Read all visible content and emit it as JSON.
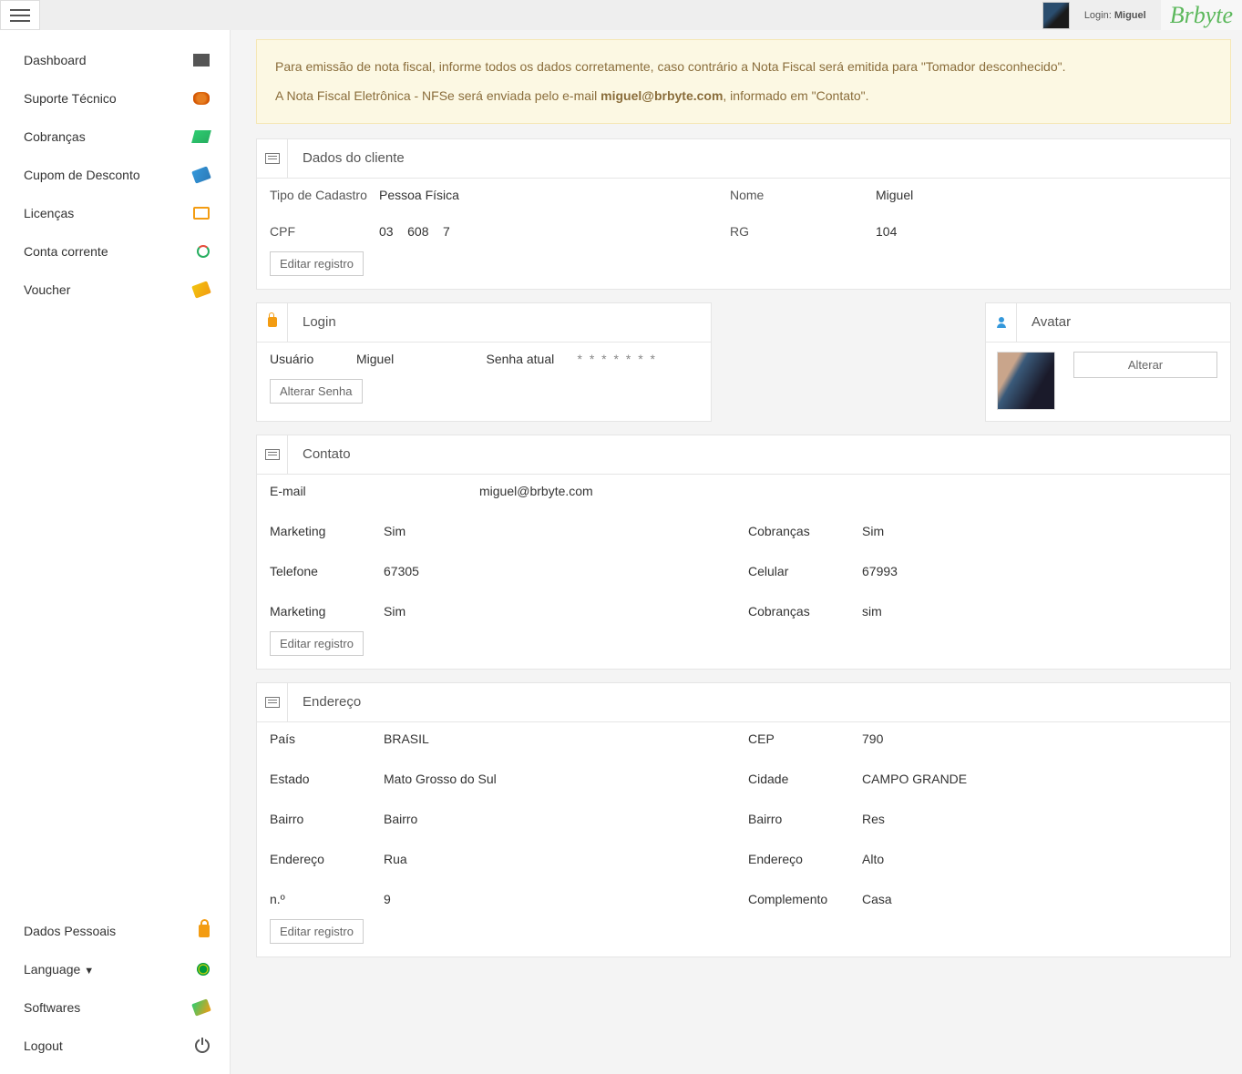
{
  "topbar": {
    "login_prefix": "Login: ",
    "login_name": "Miguel",
    "brand": "Brbyte"
  },
  "sidebar": {
    "top": [
      {
        "label": "Dashboard",
        "icon": "ic-dash"
      },
      {
        "label": "Suporte Técnico",
        "icon": "ic-support"
      },
      {
        "label": "Cobranças",
        "icon": "ic-cash"
      },
      {
        "label": "Cupom de Desconto",
        "icon": "ic-coupon"
      },
      {
        "label": "Licenças",
        "icon": "ic-card"
      },
      {
        "label": "Conta corrente",
        "icon": "ic-refresh"
      },
      {
        "label": "Voucher",
        "icon": "ic-voucher"
      }
    ],
    "bottom": [
      {
        "label": "Dados Pessoais",
        "icon": "ic-lock"
      },
      {
        "label": "Language",
        "icon": "ic-flag",
        "chevron": true
      },
      {
        "label": "Softwares",
        "icon": "ic-soft"
      },
      {
        "label": "Logout",
        "icon": "ic-power"
      }
    ]
  },
  "alert": {
    "line1": "Para emissão de nota fiscal, informe todos os dados corretamente, caso contrário a Nota Fiscal será emitida para \"Tomador desconhecido\".",
    "line2a": "A Nota Fiscal Eletrônica - NFSe será enviada pelo e-mail ",
    "line2_email": "miguel@brbyte.com",
    "line2b": ", informado em \"Contato\"."
  },
  "client": {
    "title": "Dados do cliente",
    "tipo_label": "Tipo de Cadastro",
    "tipo_value": "Pessoa Física",
    "nome_label": "Nome",
    "nome_value": "Miguel",
    "cpf_label": "CPF",
    "cpf_value": "03    608    7",
    "rg_label": "RG",
    "rg_value": "104",
    "edit_btn": "Editar registro"
  },
  "login": {
    "title": "Login",
    "user_label": "Usuário",
    "user_value": "Miguel",
    "pass_label": "Senha atual",
    "pass_value": "* * * * * * *",
    "btn": "Alterar Senha"
  },
  "avatar": {
    "title": "Avatar",
    "btn": "Alterar"
  },
  "contact": {
    "title": "Contato",
    "email_label": "E-mail",
    "email_value": "miguel@brbyte.com",
    "mkt1_label": "Marketing",
    "mkt1_value": "Sim",
    "cob1_label": "Cobranças",
    "cob1_value": "Sim",
    "tel_label": "Telefone",
    "tel_value": "67305",
    "cel_label": "Celular",
    "cel_value": "67993",
    "mkt2_label": "Marketing",
    "mkt2_value": "Sim",
    "cob2_label": "Cobranças",
    "cob2_value": "sim",
    "edit_btn": "Editar registro"
  },
  "address": {
    "title": "Endereço",
    "pais_label": "País",
    "pais_value": "BRASIL",
    "cep_label": "CEP",
    "cep_value": "790",
    "estado_label": "Estado",
    "estado_value": "Mato Grosso do Sul",
    "cidade_label": "Cidade",
    "cidade_value": "CAMPO GRANDE",
    "bairro1_label": "Bairro",
    "bairro1_value": "Bairro",
    "bairro2_label": "Bairro",
    "bairro2_value": "Res",
    "end1_label": "Endereço",
    "end1_value": "Rua",
    "end2_label": "Endereço",
    "end2_value": "Alto",
    "num_label": "n.º",
    "num_value": "9",
    "comp_label": "Complemento",
    "comp_value": "Casa",
    "edit_btn": "Editar registro"
  }
}
